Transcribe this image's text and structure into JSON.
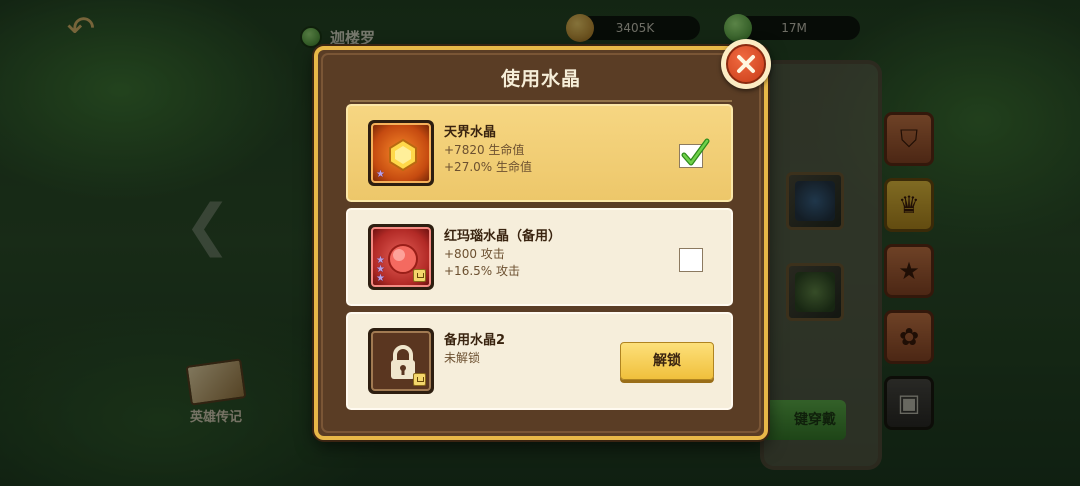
{
  "background": {
    "hero_name": "迦楼罗",
    "resources": {
      "gold": "3405K",
      "gems": "17M"
    },
    "book_label": "英雄传记",
    "wear_button_label": "键穿戴"
  },
  "modal": {
    "title": "使用水晶",
    "items": [
      {
        "name": "天界水晶",
        "stats": [
          "+7820 生命值",
          "+27.0% 生命值"
        ],
        "selected": true,
        "stars": 1
      },
      {
        "name": "红玛瑙水晶（备用）",
        "stats": [
          "+800 攻击",
          "+16.5% 攻击"
        ],
        "selected": false,
        "stars": 3
      },
      {
        "name": "备用水晶2",
        "stats": [
          "未解锁"
        ],
        "locked": true,
        "unlock_label": "解锁"
      }
    ]
  },
  "colors": {
    "modal_border": "#e8b848",
    "selected_card": "#f6d682",
    "card": "#f6eedb",
    "unlock_button": "#f0c03c",
    "close_button": "#c93c18"
  }
}
